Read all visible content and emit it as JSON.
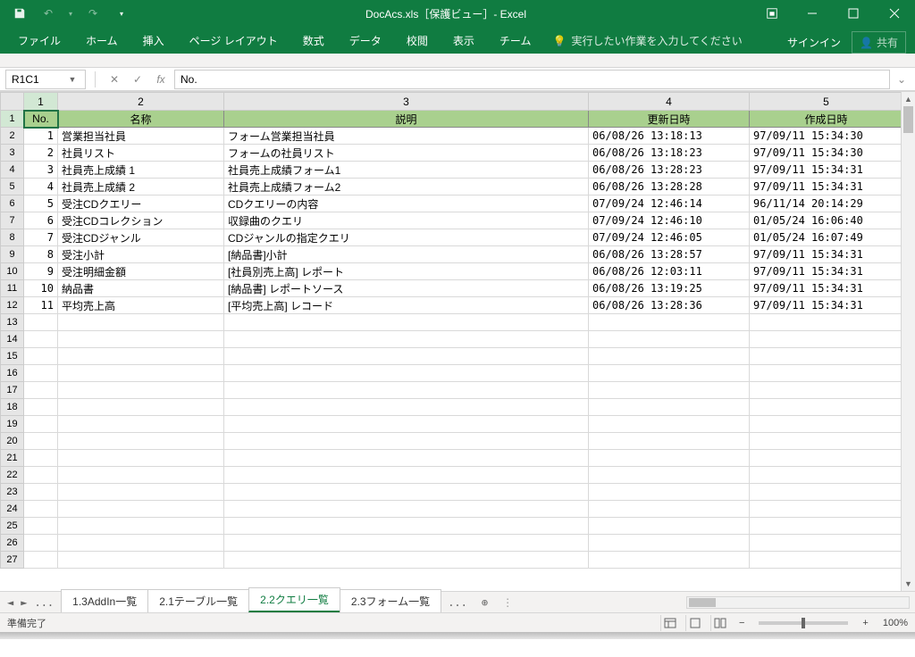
{
  "title": "DocAcs.xls［保護ビュー］- Excel",
  "qat": {
    "undo_dd": "▾",
    "redo": "↷",
    "undo": "↶",
    "more": "▾"
  },
  "ribbon_tabs": [
    "ファイル",
    "ホーム",
    "挿入",
    "ページ レイアウト",
    "数式",
    "データ",
    "校閲",
    "表示",
    "チーム"
  ],
  "tellme": "実行したい作業を入力してください",
  "signin": "サインイン",
  "share": "共有",
  "namebox": "R1C1",
  "formula": "No.",
  "col_headers": [
    "1",
    "2",
    "3",
    "4",
    "5"
  ],
  "header_row": [
    "No.",
    "名称",
    "説明",
    "更新日時",
    "作成日時"
  ],
  "data_rows": [
    {
      "no": "1",
      "name": "営業担当社員",
      "desc": "フォーム営業担当社員",
      "upd": "06/08/26 13:18:13",
      "crt": "97/09/11 15:34:30"
    },
    {
      "no": "2",
      "name": "社員リスト",
      "desc": "フォームの社員リスト",
      "upd": "06/08/26 13:18:23",
      "crt": "97/09/11 15:34:30"
    },
    {
      "no": "3",
      "name": "社員売上成績 1",
      "desc": "社員売上成績フォーム1",
      "upd": "06/08/26 13:28:23",
      "crt": "97/09/11 15:34:31"
    },
    {
      "no": "4",
      "name": "社員売上成績 2",
      "desc": "社員売上成績フォーム2",
      "upd": "06/08/26 13:28:28",
      "crt": "97/09/11 15:34:31"
    },
    {
      "no": "5",
      "name": "受注CDクエリー",
      "desc": "CDクエリーの内容",
      "upd": "07/09/24 12:46:14",
      "crt": "96/11/14 20:14:29"
    },
    {
      "no": "6",
      "name": "受注CDコレクション",
      "desc": "収録曲のクエリ",
      "upd": "07/09/24 12:46:10",
      "crt": "01/05/24 16:06:40"
    },
    {
      "no": "7",
      "name": "受注CDジャンル",
      "desc": "CDジャンルの指定クエリ",
      "upd": "07/09/24 12:46:05",
      "crt": "01/05/24 16:07:49"
    },
    {
      "no": "8",
      "name": "受注小計",
      "desc": "[納品書]小計",
      "upd": "06/08/26 13:28:57",
      "crt": "97/09/11 15:34:31"
    },
    {
      "no": "9",
      "name": "受注明細金額",
      "desc": "[社員別売上高] レポート",
      "upd": "06/08/26 12:03:11",
      "crt": "97/09/11 15:34:31"
    },
    {
      "no": "10",
      "name": "納品書",
      "desc": "[納品書] レポートソース",
      "upd": "06/08/26 13:19:25",
      "crt": "97/09/11 15:34:31"
    },
    {
      "no": "11",
      "name": "平均売上高",
      "desc": "[平均売上高] レコード",
      "upd": "06/08/26 13:28:36",
      "crt": "97/09/11 15:34:31"
    }
  ],
  "empty_rows_start": 13,
  "empty_rows_end": 27,
  "sheet_tabs": {
    "prefix": "...",
    "tabs": [
      "1.3AddIn一覧",
      "2.1テーブル一覧",
      "2.2クエリ一覧",
      "2.3フォーム一覧"
    ],
    "active_index": 2,
    "suffix": "..."
  },
  "status_text": "準備完了",
  "zoom": "100%"
}
